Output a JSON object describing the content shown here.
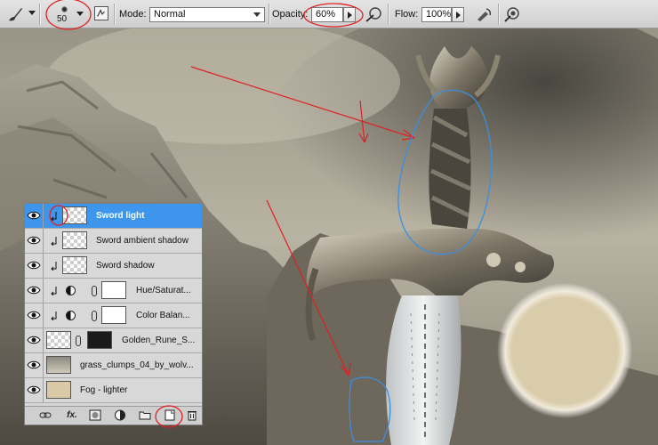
{
  "options_bar": {
    "tool_icon": "brush-icon",
    "brush_size": "50",
    "mode_label": "Mode:",
    "mode_value": "Normal",
    "opacity_label": "Opacity:",
    "opacity_value": "60%",
    "flow_label": "Flow:",
    "flow_value": "100%",
    "airbrush_icon": "airbrush-icon",
    "tablet_pressure_icon": "tablet-pressure-icon"
  },
  "layers_panel": {
    "layers": [
      {
        "name": "Sword light",
        "selected": true,
        "clipped": true,
        "thumb": "transparent"
      },
      {
        "name": "Sword ambient shadow",
        "selected": false,
        "clipped": true,
        "thumb": "transparent"
      },
      {
        "name": "Sword shadow",
        "selected": false,
        "clipped": true,
        "thumb": "transparent"
      },
      {
        "name": "Hue/Saturat...",
        "selected": false,
        "clipped": true,
        "thumb": "adjustment"
      },
      {
        "name": "Color Balan...",
        "selected": false,
        "clipped": true,
        "thumb": "adjustment"
      },
      {
        "name": "Golden_Rune_S...",
        "selected": false,
        "clipped": false,
        "thumb": "masked"
      },
      {
        "name": "grass_clumps_04_by_wolv...",
        "selected": false,
        "clipped": false,
        "thumb": "rock"
      },
      {
        "name": "Fog - lighter",
        "selected": false,
        "clipped": false,
        "thumb": "fog"
      }
    ],
    "footer_icons": [
      "link-icon",
      "fx-icon",
      "mask-icon",
      "adjustment-icon",
      "folder-icon",
      "new-layer-icon",
      "trash-icon"
    ],
    "fx_label": "fx."
  },
  "colors": {
    "selection": "#3d95ec",
    "annotation_red": "#e02020",
    "annotation_blue": "#3a8fe0",
    "brush_preview": "#d9ccaa"
  }
}
